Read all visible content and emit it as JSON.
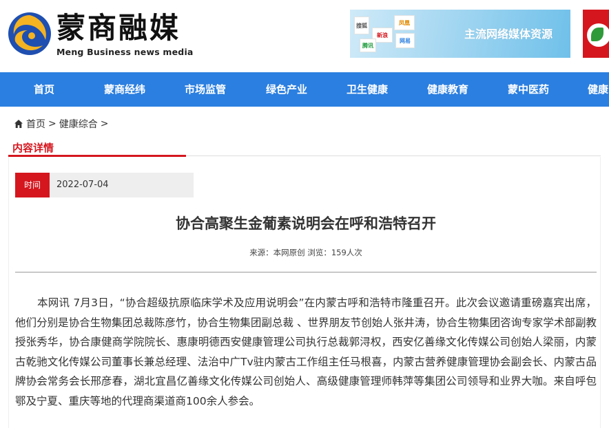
{
  "header": {
    "logo_cn": "蒙商融媒",
    "logo_en": "Meng Business news media",
    "banner_title": "主流网络媒体资源",
    "banner_tiles": [
      "搜狐",
      "新浪",
      "凤凰",
      "网易",
      "腾讯"
    ]
  },
  "nav": {
    "items": [
      "首页",
      "蒙商经纬",
      "市场监管",
      "绿色产业",
      "卫生健康",
      "健康教育",
      "蒙中医药",
      "健康"
    ]
  },
  "breadcrumb": {
    "home": "首页",
    "separator": ">",
    "category": "健康综合"
  },
  "section": {
    "title": "内容详情"
  },
  "article": {
    "time_label": "时间",
    "date": "2022-07-04",
    "title": "协合高聚生金葡素说明会在呼和浩特召开",
    "meta": "来源：本网原创 浏览：159人次",
    "body": "本网讯 7月3日，“协合超级抗原临床学术及应用说明会”在内蒙古呼和浩特市隆重召开。此次会议邀请重磅嘉宾出席，他们分别是协合生物集团总裁陈彦竹，协合生物集团副总裁 、世界朋友节创始人张井涛，协合生物集团咨询专家学术部副教授张秀华，协合康健商学院院长、惠康明德西安健康管理公司执行总裁郭浔权，西安亿善缘文化传媒公司创始人梁丽，内蒙古乾驰文化传媒公司董事长兼总经理、法治中广Tv驻内蒙古工作组主任马根喜，内蒙古营养健康管理协会副会长、内蒙古品牌协会常务会长邢彦春，湖北宜昌亿善缘文化传媒公司创始人、高级健康管理师韩萍等集团公司领导和业界大咖。来自呼包鄂及宁夏、重庆等地的代理商渠道商100余人参会。"
  },
  "colors": {
    "nav_bg": "#2b7fe0",
    "accent_red": "#d5161e"
  }
}
